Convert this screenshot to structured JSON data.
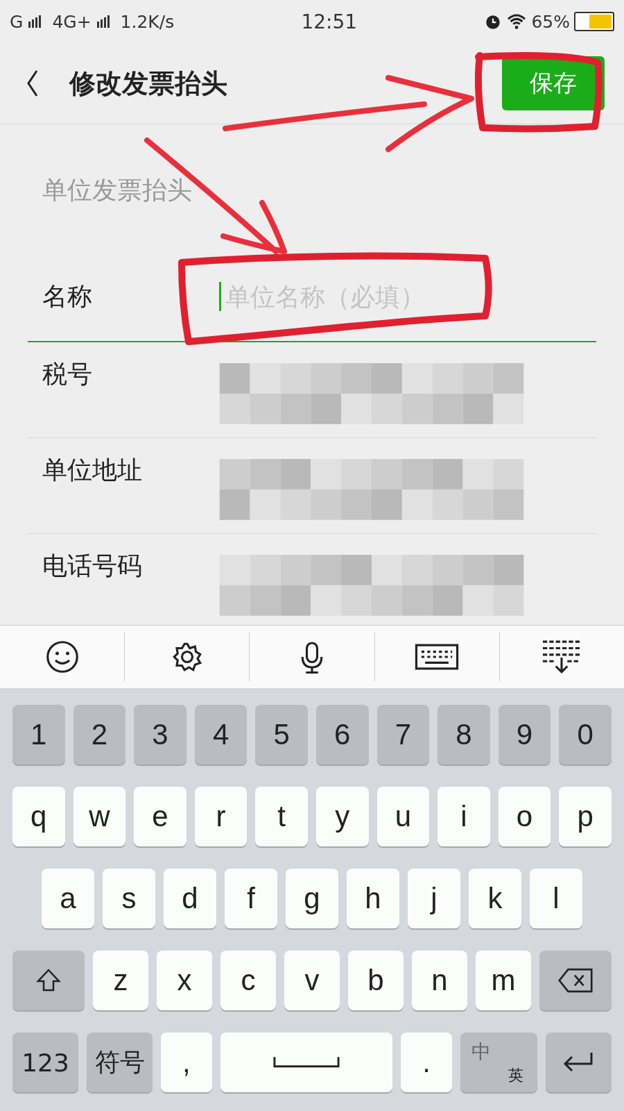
{
  "status_bar": {
    "network_1": "G",
    "network_2": "4G+",
    "speed": "1.2K/s",
    "time": "12:51",
    "battery": "65%"
  },
  "header": {
    "title": "修改发票抬头",
    "save_button": "保存"
  },
  "section_label": "单位发票抬头",
  "name_field": {
    "label": "名称",
    "placeholder": "单位名称（必填）"
  },
  "rows": [
    {
      "label": "税号",
      "redacted": true
    },
    {
      "label": "单位地址",
      "redacted": true
    },
    {
      "label": "电话号码",
      "redacted": true
    }
  ],
  "keyboard_toolbar": [
    {
      "kind": "emoji"
    },
    {
      "kind": "settings"
    },
    {
      "kind": "mic"
    },
    {
      "kind": "keyboard"
    },
    {
      "kind": "collapse"
    }
  ],
  "keyboard_rows": [
    [
      {
        "kind": "func",
        "label": "1"
      },
      {
        "kind": "func",
        "label": "2"
      },
      {
        "kind": "func",
        "label": "3"
      },
      {
        "kind": "func",
        "label": "4"
      },
      {
        "kind": "func",
        "label": "5"
      },
      {
        "kind": "func",
        "label": "6"
      },
      {
        "kind": "func",
        "label": "7"
      },
      {
        "kind": "func",
        "label": "8"
      },
      {
        "kind": "func",
        "label": "9"
      },
      {
        "kind": "func",
        "label": "0"
      }
    ],
    [
      {
        "kind": "char",
        "label": "q"
      },
      {
        "kind": "char",
        "label": "w"
      },
      {
        "kind": "char",
        "label": "e"
      },
      {
        "kind": "char",
        "label": "r"
      },
      {
        "kind": "char",
        "label": "t"
      },
      {
        "kind": "char",
        "label": "y"
      },
      {
        "kind": "char",
        "label": "u"
      },
      {
        "kind": "char",
        "label": "i"
      },
      {
        "kind": "char",
        "label": "o"
      },
      {
        "kind": "char",
        "label": "p"
      }
    ],
    [
      {
        "kind": "char",
        "label": "a"
      },
      {
        "kind": "char",
        "label": "s"
      },
      {
        "kind": "char",
        "label": "d"
      },
      {
        "kind": "char",
        "label": "f"
      },
      {
        "kind": "char",
        "label": "g"
      },
      {
        "kind": "char",
        "label": "h"
      },
      {
        "kind": "char",
        "label": "j"
      },
      {
        "kind": "char",
        "label": "k"
      },
      {
        "kind": "char",
        "label": "l"
      }
    ],
    [
      {
        "kind": "shift"
      },
      {
        "kind": "char",
        "label": "z"
      },
      {
        "kind": "char",
        "label": "x"
      },
      {
        "kind": "char",
        "label": "c"
      },
      {
        "kind": "char",
        "label": "v"
      },
      {
        "kind": "char",
        "label": "b"
      },
      {
        "kind": "char",
        "label": "n"
      },
      {
        "kind": "char",
        "label": "m"
      },
      {
        "kind": "backspace"
      }
    ],
    [
      {
        "kind": "wide",
        "label": "123"
      },
      {
        "kind": "wide",
        "label": "符号"
      },
      {
        "kind": "char",
        "label": ","
      },
      {
        "kind": "space"
      },
      {
        "kind": "char",
        "label": "."
      },
      {
        "kind": "lang",
        "label": "中",
        "sub": "英"
      },
      {
        "kind": "enter"
      }
    ]
  ],
  "annotations": [
    {
      "kind": "outline"
    },
    {
      "kind": "arrow"
    },
    {
      "kind": "arrow"
    },
    {
      "kind": "outline"
    }
  ]
}
